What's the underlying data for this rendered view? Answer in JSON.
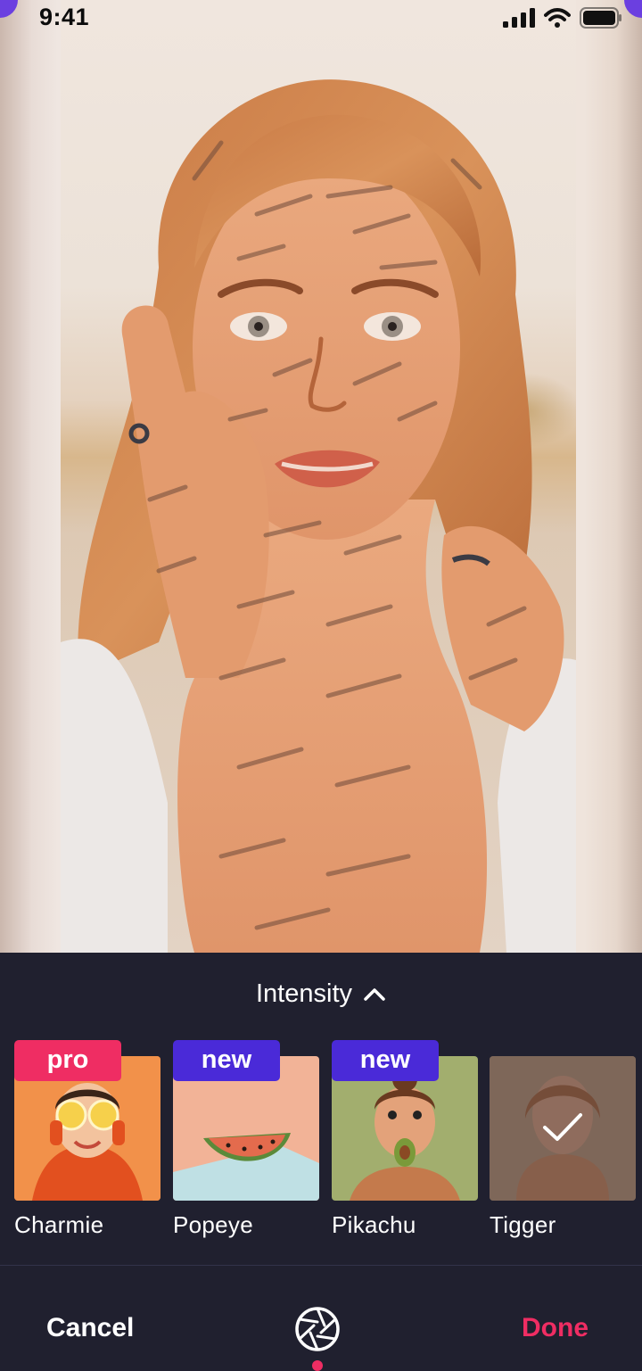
{
  "status_bar": {
    "time": "9:41"
  },
  "panel": {
    "intensity_label": "Intensity",
    "filters": [
      {
        "name": "Charmie",
        "badge": "pro",
        "selected": false
      },
      {
        "name": "Popeye",
        "badge": "new",
        "selected": false
      },
      {
        "name": "Pikachu",
        "badge": "new",
        "selected": false
      },
      {
        "name": "Tigger",
        "badge": "",
        "selected": true
      }
    ]
  },
  "bottom_bar": {
    "cancel_label": "Cancel",
    "done_label": "Done",
    "center_icon": "aperture-icon"
  },
  "colors": {
    "panel_bg": "#20202f",
    "pro_badge": "#ef2d63",
    "new_badge": "#4a2ad8",
    "done": "#ef2d63",
    "accent_purple": "#6b3fe0"
  }
}
